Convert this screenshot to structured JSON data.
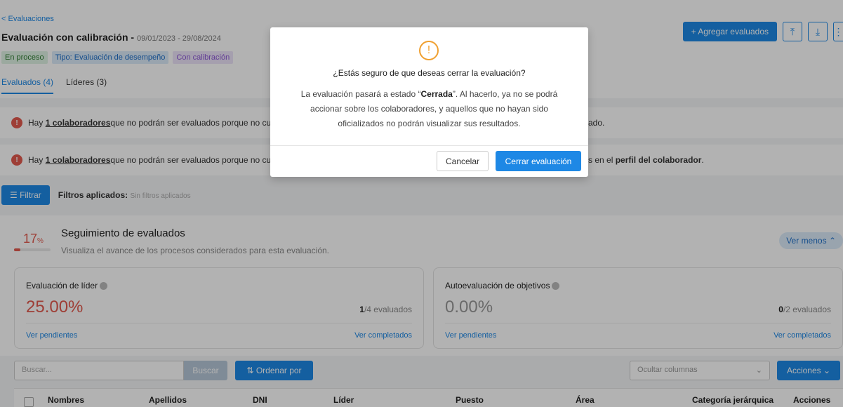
{
  "header": {
    "back_link": "< Evaluaciones",
    "title": "Evaluación con calibración",
    "dates": "09/01/2023 - 29/08/2024",
    "title_separator": " - ",
    "tags": [
      "En proceso",
      "Tipo: Evaluación de desempeño",
      "Con calibración"
    ],
    "add_button": "+ Agregar evaluados",
    "upload_icon": "upload-icon",
    "download_icon": "download-icon",
    "more_icon": "more-icon"
  },
  "tabs": [
    "Evaluados (4)",
    "Líderes (3)"
  ],
  "alerts": [
    {
      "prefix": "Hay ",
      "link": "1 colaboradores",
      "text": " que no podrán ser evaluados porque no cu",
      "tail": "ado."
    },
    {
      "prefix": "Hay ",
      "link": "1 colaboradores",
      "text": " que no podrán ser evaluados porque no cu",
      "tail_pre": "s en el ",
      "tail_bold": "perfil del colaborador",
      "tail_end": "."
    }
  ],
  "filters": {
    "button": "Filtrar",
    "label": "Filtros aplicados:",
    "value": "Sin filtros aplicados"
  },
  "seguimiento": {
    "percent": "17",
    "percent_unit": "%",
    "progress": 0.17,
    "title": "Seguimiento de evaluados",
    "subtitle": "Visualiza el avance de los procesos considerados para esta evaluación.",
    "toggle": "Ver menos"
  },
  "cards": [
    {
      "title": "Evaluación de líder",
      "percent": "25.00%",
      "percent_color": "#e25a4e",
      "count_done": "1",
      "count_total": "/4 evaluados",
      "pending": "Ver pendientes",
      "completed": "Ver completados"
    },
    {
      "title": "Autoevaluación de objetivos",
      "percent": "0.00%",
      "percent_color": "#999999",
      "count_done": "0",
      "count_total": "/2 evaluados",
      "pending": "Ver pendientes",
      "completed": "Ver completados"
    }
  ],
  "toolbar": {
    "search_placeholder": "Buscar...",
    "search_button": "Buscar",
    "order_button": "Ordenar por",
    "hide_columns": "Ocultar columnas",
    "actions_button": "Acciones"
  },
  "table": {
    "columns": [
      "Nombres",
      "Apellidos",
      "DNI",
      "Líder",
      "Puesto",
      "Área",
      "Categoría jerárquica",
      "Acciones"
    ]
  },
  "modal": {
    "title": "¿Estás seguro de que deseas cerrar la evaluación?",
    "body_pre": "La evaluación pasará a estado “",
    "body_bold": "Cerrada",
    "body_post": "”. Al hacerlo, ya no se podrá accionar sobre los colaboradores, y aquellos que no hayan sido oficializados no podrán visualizar sus resultados.",
    "cancel": "Cancelar",
    "confirm": "Cerrar evaluación"
  }
}
